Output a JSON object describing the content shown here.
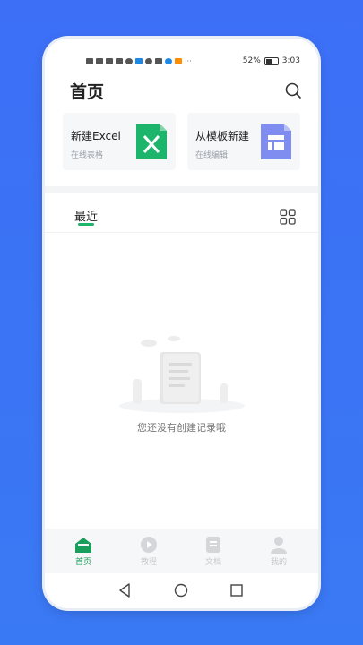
{
  "status_bar": {
    "battery_percent": "52%",
    "time": "3:03",
    "left_indicators": [
      "hd-icon",
      "b-icon",
      "signal-icon",
      "signal-icon",
      "wifi-icon",
      "app-icon",
      "app-icon",
      "cart-icon",
      "app-icon",
      "app-icon",
      "more-icon"
    ],
    "more_label": "···"
  },
  "header": {
    "title": "首页",
    "search_icon": "search-icon"
  },
  "cards": [
    {
      "title": "新建Excel",
      "subtitle": "在线表格",
      "icon": "excel-file-icon",
      "accent": "#1db46b"
    },
    {
      "title": "从模板新建",
      "subtitle": "在线编辑",
      "icon": "template-file-icon",
      "accent": "#7f8df0"
    }
  ],
  "recent": {
    "tab_label": "最近",
    "grid_icon": "grid-view-icon",
    "accent": "#1db46b"
  },
  "empty_state": {
    "message": "您还没有创建记录哦",
    "illustration_icon": "empty-document-illustration"
  },
  "bottom_nav": [
    {
      "label": "首页",
      "icon": "home-icon",
      "active": true
    },
    {
      "label": "教程",
      "icon": "play-icon",
      "active": false
    },
    {
      "label": "文档",
      "icon": "document-icon",
      "active": false
    },
    {
      "label": "我的",
      "icon": "person-icon",
      "active": false
    }
  ],
  "system_nav": [
    "back-icon",
    "home-circle-icon",
    "recents-icon"
  ]
}
